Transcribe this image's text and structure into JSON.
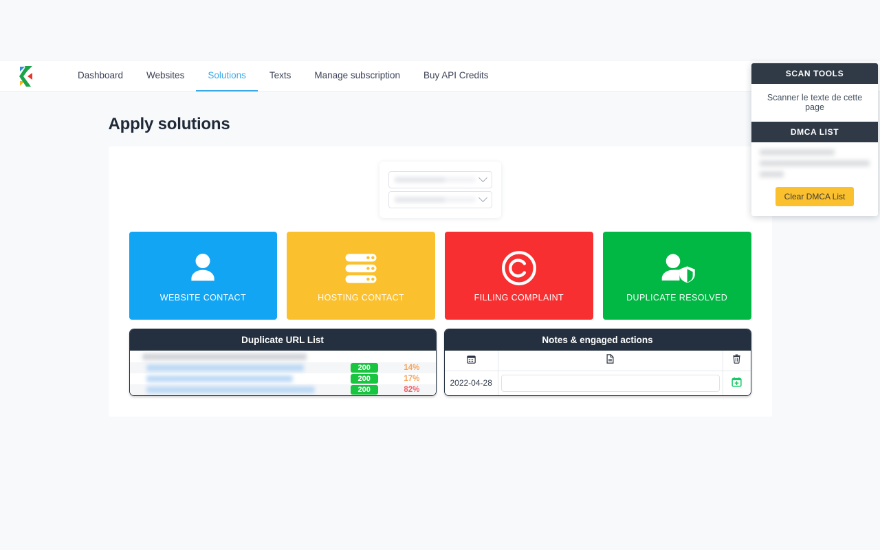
{
  "brand": {
    "logo_name": "kezia-k-logo"
  },
  "nav": {
    "items": [
      {
        "label": "Dashboard",
        "active": false
      },
      {
        "label": "Websites",
        "active": false
      },
      {
        "label": "Solutions",
        "active": true
      },
      {
        "label": "Texts",
        "active": false
      },
      {
        "label": "Manage subscription",
        "active": false
      },
      {
        "label": "Buy API Credits",
        "active": false
      }
    ]
  },
  "page": {
    "title": "Apply solutions"
  },
  "selectors": {
    "select_1": {
      "value": "",
      "redacted": true
    },
    "select_2": {
      "value": "",
      "redacted": true
    },
    "caret_icon": "chevron-down-icon"
  },
  "tiles": [
    {
      "label": "WEBSITE CONTACT",
      "color": "#12a5f4",
      "icon": "user-icon"
    },
    {
      "label": "HOSTING CONTACT",
      "color": "#fbc02d",
      "icon": "server-icon"
    },
    {
      "label": "FILLING COMPLAINT",
      "color": "#f82f31",
      "icon": "copyright-icon"
    },
    {
      "label": "DUPLICATE RESOLVED",
      "color": "#00b843",
      "icon": "user-shield-icon"
    }
  ],
  "duplicate_list": {
    "title": "Duplicate URL List",
    "source_row": {
      "redacted": true
    },
    "rows": [
      {
        "url": "",
        "redacted": true,
        "code": "200",
        "percent": "14%",
        "percent_level": "warn"
      },
      {
        "url": "",
        "redacted": true,
        "code": "200",
        "percent": "17%",
        "percent_level": "warn"
      },
      {
        "url": "",
        "redacted": true,
        "code": "200",
        "percent": "82%",
        "percent_level": "danger"
      }
    ]
  },
  "notes": {
    "title": "Notes & engaged actions",
    "columns": [
      {
        "icon": "calendar-icon"
      },
      {
        "icon": "document-icon"
      },
      {
        "icon": "trash-icon"
      }
    ],
    "rows": [
      {
        "date": "2022-04-28",
        "note": "",
        "note_placeholder": "",
        "action_icon": "calendar-plus-icon"
      }
    ]
  },
  "scan_tools": {
    "title": "SCAN TOOLS",
    "items": [
      {
        "label": "Scanner le texte de cette page"
      }
    ]
  },
  "dmca": {
    "title": "DMCA LIST",
    "entries_redacted": true,
    "clear_button": "Clear DMCA List"
  },
  "colors": {
    "accent": "#3aa9e8",
    "panel_header": "#24303f",
    "badge_green": "#17c53e",
    "warn": "#f5a55c",
    "danger": "#f2616a",
    "amber": "#fbc02d",
    "page_bg": "#f7f9fb"
  }
}
